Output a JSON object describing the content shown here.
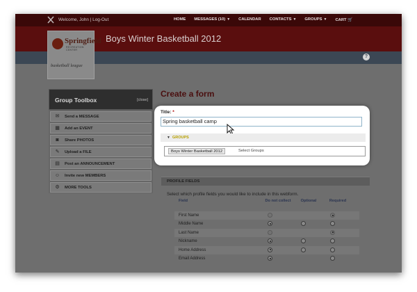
{
  "topbar": {
    "welcome": "Welcome, John | Log-Out",
    "nav": [
      {
        "label": "HOME",
        "dropdown": false
      },
      {
        "label": "MESSAGES (10)",
        "dropdown": true
      },
      {
        "label": "CALENDAR",
        "dropdown": false
      },
      {
        "label": "CONTACTS",
        "dropdown": true
      },
      {
        "label": "GROUPS",
        "dropdown": true
      },
      {
        "label": "CART",
        "dropdown": false
      }
    ]
  },
  "header": {
    "title": "Boys Winter Basketball 2012",
    "logo": {
      "name": "Springfield",
      "subtitle": "RECREATION CENTER",
      "league": "basketball league"
    },
    "help_glyph": "?"
  },
  "toolbox": {
    "title": "Group Toolbox",
    "close_label": "[close]",
    "items": [
      {
        "label": "Send a MESSAGE",
        "icon": "megaphone-icon",
        "glyph": "✉"
      },
      {
        "label": "Add an EVENT",
        "icon": "calendar-icon",
        "glyph": "▦"
      },
      {
        "label": "Share PHOTOS",
        "icon": "camera-icon",
        "glyph": "◙"
      },
      {
        "label": "Upload a FILE",
        "icon": "pen-icon",
        "glyph": "✎"
      },
      {
        "label": "Post an ANNOUNCEMENT",
        "icon": "bulletin-icon",
        "glyph": "▤"
      },
      {
        "label": "Invite new MEMBERS",
        "icon": "people-icon",
        "glyph": "☺"
      },
      {
        "label": "MORE TOOLS",
        "icon": "gear-icon",
        "glyph": "⚙"
      }
    ]
  },
  "form": {
    "heading": "Create a form",
    "title_label": "Title:",
    "title_required": "*",
    "title_value": "Spring basketball camp",
    "groups_label": "GROUPS",
    "selected_group": "Boys Winter Basketball 2012",
    "select_groups_placeholder": "Select Groups"
  },
  "profile_fields": {
    "section_title": "PROFILE FIELDS",
    "instruction": "Select which profile fields you would like to include in this webform.",
    "columns": {
      "field": "Field",
      "do_not_collect": "Do not collect",
      "optional": "Optional",
      "required": "Required"
    },
    "rows": [
      {
        "name": "First Name",
        "choices": [
          "off",
          "none",
          "on"
        ]
      },
      {
        "name": "Middle Name",
        "choices": [
          "on",
          "off",
          "off"
        ]
      },
      {
        "name": "Last Name",
        "choices": [
          "off",
          "none",
          "on"
        ]
      },
      {
        "name": "Nickname",
        "choices": [
          "on",
          "off",
          "off"
        ]
      },
      {
        "name": "Home Address",
        "choices": [
          "on",
          "off",
          "off"
        ]
      },
      {
        "name": "Email Address",
        "choices": [
          "on",
          "none",
          "off"
        ]
      }
    ]
  }
}
